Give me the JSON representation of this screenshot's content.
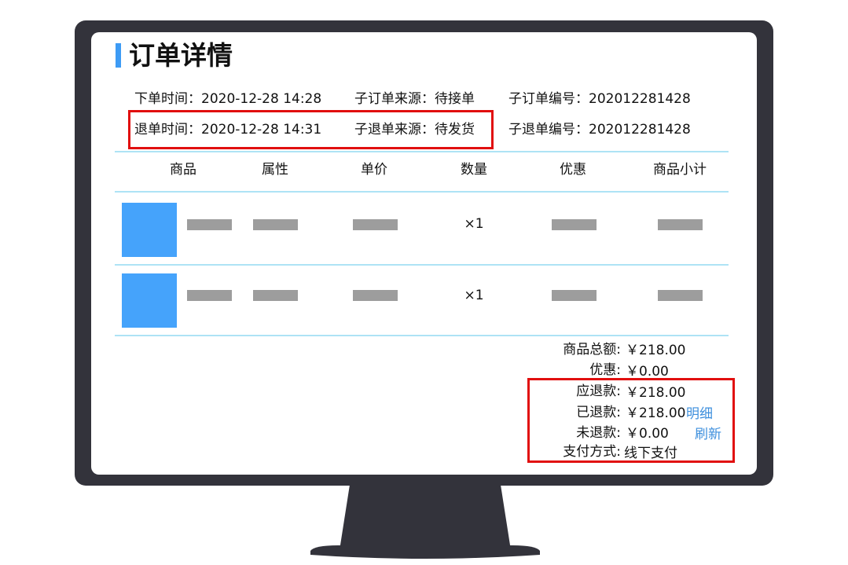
{
  "page": {
    "title": "订单详情"
  },
  "order_info": {
    "row1": {
      "order_time": "下单时间：2020-12-28 14:28",
      "sub_order_source": "子订单来源：待接单",
      "sub_order_no": "子订单编号：202012281428"
    },
    "row2": {
      "refund_time": "退单时间：2020-12-28 14:31",
      "sub_refund_source": "子退单来源：待发货",
      "sub_refund_no": "子退单编号：202012281428"
    }
  },
  "table": {
    "headers": [
      "商品",
      "属性",
      "单价",
      "数量",
      "优惠",
      "商品小计"
    ],
    "rows": [
      {
        "qty": "×1"
      },
      {
        "qty": "×1"
      }
    ]
  },
  "summary": {
    "goods_total_label": "商品总额:",
    "goods_total_value": "￥218.00",
    "discount_label": "优惠:",
    "discount_value": "￥0.00",
    "refund_due_label": "应退款:",
    "refund_due_value": "￥218.00",
    "refunded_label": "已退款:",
    "refunded_value": "￥218.00",
    "detail_link": "明细",
    "unrefunded_label": "未退款:",
    "unrefunded_value": "￥0.00",
    "refresh_link": "刷新",
    "pay_method_label": "支付方式:",
    "pay_method_value": "线下支付"
  },
  "colors": {
    "accent": "#3d9bf5",
    "highlight_box": "#e10f0f",
    "divider": "#aee3f5",
    "thumbnail": "#45a3fb",
    "placeholder": "#9d9d9d",
    "link": "#3d8fdd"
  }
}
